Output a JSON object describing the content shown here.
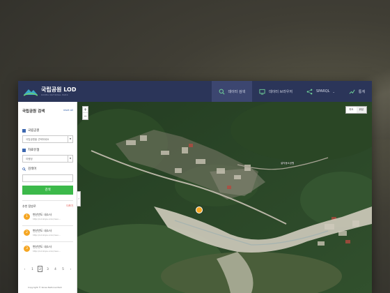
{
  "header": {
    "logo_title": "국립공원 LOD",
    "logo_sub": "KOREA NATIONAL PARK",
    "nav": [
      {
        "label": "데이터 검색",
        "icon": "search-icon",
        "active": true
      },
      {
        "label": "데이터 브라우저",
        "icon": "browser-icon",
        "active": false
      },
      {
        "label": "SPARQL",
        "icon": "share-icon",
        "active": false
      },
      {
        "label": "통계",
        "icon": "chart-icon",
        "active": false
      }
    ]
  },
  "sidebar": {
    "title": "국립공원 검색",
    "reset_label": "reset all",
    "park_label": "국립공원",
    "park_placeholder": "국립공원을 선택하세요",
    "resource_label": "자료유형",
    "resource_value": "여행정",
    "keyword_label": "검색어",
    "search_button": "검색",
    "recommend_title": "추천 탐방로",
    "recommend_more": "더보기",
    "recommend_items": [
      {
        "num": "1",
        "title": "변산반도 내소사",
        "url": "http://lod.knps.or.kr/reso..."
      },
      {
        "num": "2",
        "title": "변산반도 내소사",
        "url": "http://lod.knps.or.kr/reso..."
      },
      {
        "num": "3",
        "title": "변산반도 내소사",
        "url": "http://lod.knps.or.kr/reso..."
      }
    ],
    "pager": {
      "prev": "‹",
      "pages": [
        "1",
        "2",
        "3",
        "4",
        "5"
      ],
      "next": "›",
      "active": "2"
    },
    "copyright": "Copyright © Korea National Park"
  },
  "map": {
    "type_options": [
      "지도",
      "위성"
    ],
    "zoom_in": "+",
    "zoom_out": "−",
    "collapse": "›",
    "labels": [
      "설악동소공원"
    ]
  }
}
